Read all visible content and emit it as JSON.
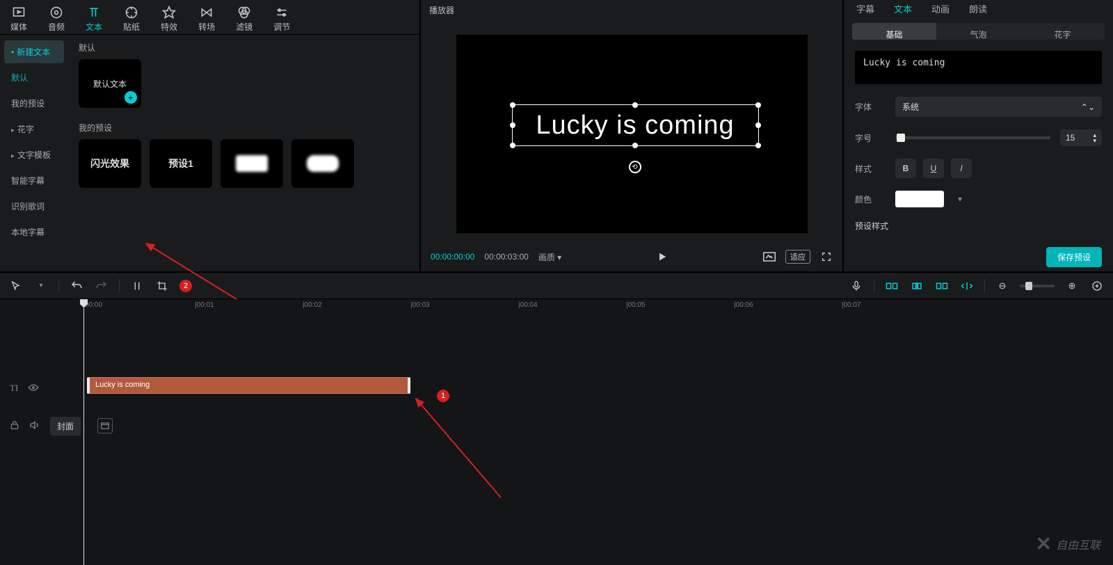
{
  "toolTabs": [
    {
      "label": "媒体"
    },
    {
      "label": "音频"
    },
    {
      "label": "文本"
    },
    {
      "label": "贴纸"
    },
    {
      "label": "特效"
    },
    {
      "label": "转场"
    },
    {
      "label": "滤镜"
    },
    {
      "label": "调节"
    }
  ],
  "sideMenu": {
    "newText": "新建文本",
    "default": "默认",
    "myPresets": "我的预设",
    "fancy": "花字",
    "textTemplate": "文字模板",
    "smartSub": "智能字幕",
    "lyrics": "识别歌词",
    "localSub": "本地字幕"
  },
  "section1": "默认",
  "defaultTextThumb": "默认文本",
  "section2": "我的预设",
  "presetThumbs": [
    "闪光效果",
    "预设1"
  ],
  "playerTitle": "播放器",
  "previewText": "Lucky is coming",
  "time": {
    "cur": "00:00:00:00",
    "dur": "00:00:03:00",
    "quality": "画质"
  },
  "rightTabs": [
    "字幕",
    "文本",
    "动画",
    "朗读"
  ],
  "rightSubTabs": [
    "基础",
    "气泡",
    "花字"
  ],
  "textValue": "Lucky is coming",
  "labels": {
    "font": "字体",
    "size": "字号",
    "style": "样式",
    "color": "颜色",
    "presetStyle": "预设样式"
  },
  "fontValue": "系统",
  "sizeValue": "15",
  "savePreset": "保存预设",
  "fitLabel": "适应",
  "ruler": [
    "00:00",
    "|00:01",
    "|00:02",
    "|00:03",
    "|00:04",
    "|00:05",
    "|00:06",
    "|00:07"
  ],
  "clipLabel": "Lucky is coming",
  "coverBtn": "封面",
  "markers": {
    "m1": "1",
    "m2": "2"
  },
  "watermark": "自由互联"
}
